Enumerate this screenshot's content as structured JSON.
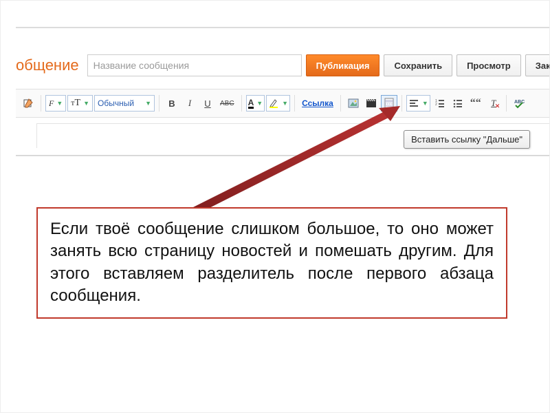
{
  "header": {
    "pageTitleFragment": "общение",
    "titlePlaceholder": "Название сообщения",
    "publishBtn": "Публикация",
    "saveBtn": "Сохранить",
    "previewBtn": "Просмотр",
    "closeBtn": "Закр"
  },
  "toolbar": {
    "compose": "Создать",
    "fontDrop": "F",
    "sizeDrop": "тT",
    "formatDrop": "Обычный",
    "bold": "B",
    "italic": "I",
    "underline": "U",
    "strike": "ABC",
    "textColor": "A",
    "bgColor": "Фон",
    "linkLabel": "Ссылка",
    "image": "Изображение",
    "video": "Видео",
    "readmore": "Разделитель",
    "alignDrop": "Выравнивание",
    "olist": "Нумерованный список",
    "ulist": "Маркированный список",
    "quote": "Цитата",
    "clearFmt": "Очистить форматирование",
    "spell": "Проверка орфографии"
  },
  "tooltip": "Вставить ссылку \"Дальше\"",
  "explain": "Если твоё сообщение слишком большое, то оно может занять всю страницу новостей и помешать другим. Для этого вставляем разделитель  после первого абзаца сообщения."
}
